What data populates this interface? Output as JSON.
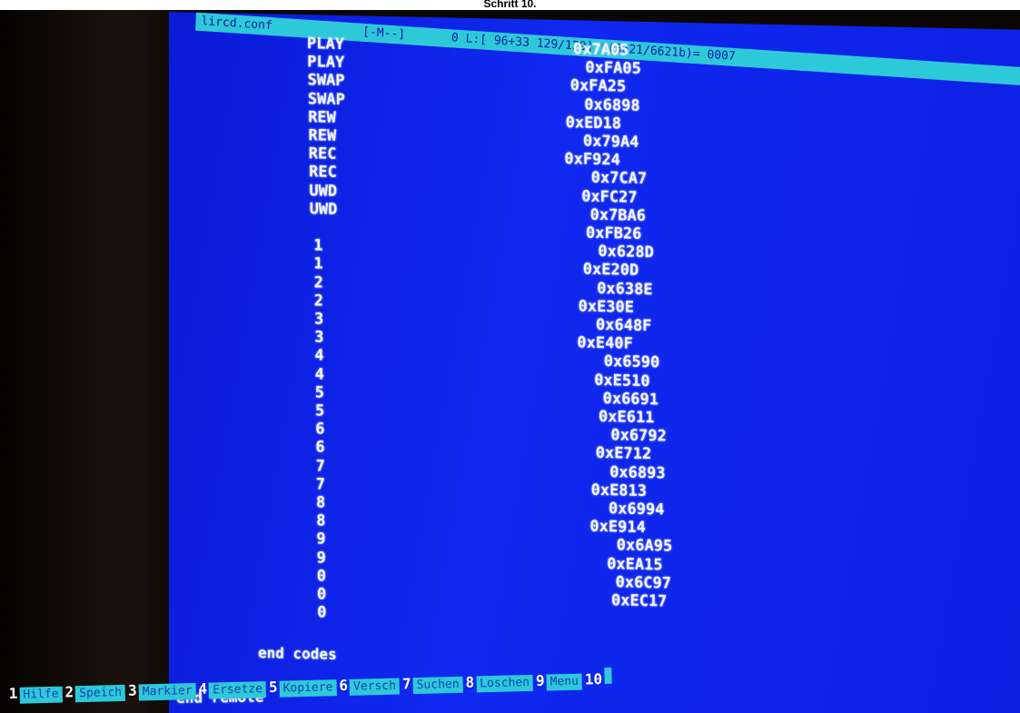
{
  "caption": "Schritt 10.",
  "titlebar": {
    "filename": "lircd.conf",
    "mode": "[-M--]",
    "position": "0 L:[ 96+33 129/129] *(6621/6621b)= 0007"
  },
  "rows": [
    {
      "key": "PLAY",
      "code": "0x7A05"
    },
    {
      "key": "PLAY",
      "code": "0xFA05"
    },
    {
      "key": "SWAP",
      "code": "0xFA25"
    },
    {
      "key": "SWAP",
      "code": "0x6898"
    },
    {
      "key": "REW",
      "code": "0xED18"
    },
    {
      "key": "REW",
      "code": "0x79A4"
    },
    {
      "key": "REC",
      "code": "0xF924"
    },
    {
      "key": "REC",
      "code": "0x7CA7"
    },
    {
      "key": "UWD",
      "code": "0xFC27"
    },
    {
      "key": "UWD",
      "code": "0x7BA6"
    },
    {
      "key": "",
      "code": "0xFB26"
    },
    {
      "key": "1",
      "code": "0x628D"
    },
    {
      "key": "1",
      "code": "0xE20D"
    },
    {
      "key": "2",
      "code": "0x638E"
    },
    {
      "key": "2",
      "code": "0xE30E"
    },
    {
      "key": "3",
      "code": "0x648F"
    },
    {
      "key": "3",
      "code": "0xE40F"
    },
    {
      "key": "4",
      "code": "0x6590"
    },
    {
      "key": "4",
      "code": "0xE510"
    },
    {
      "key": "5",
      "code": "0x6691"
    },
    {
      "key": "5",
      "code": "0xE611"
    },
    {
      "key": "6",
      "code": "0x6792"
    },
    {
      "key": "6",
      "code": "0xE712"
    },
    {
      "key": "7",
      "code": "0x6893"
    },
    {
      "key": "7",
      "code": "0xE813"
    },
    {
      "key": "8",
      "code": "0x6994"
    },
    {
      "key": "8",
      "code": "0xE914"
    },
    {
      "key": "9",
      "code": "0x6A95"
    },
    {
      "key": "9",
      "code": "0xEA15"
    },
    {
      "key": "0",
      "code": "0x6C97"
    },
    {
      "key": "0",
      "code": "0xEC17"
    },
    {
      "key": "0",
      "code": ""
    }
  ],
  "end_codes": "end codes",
  "end_remote": "end remote",
  "function_keys": [
    {
      "num": "1",
      "label": "Hilfe"
    },
    {
      "num": "2",
      "label": "Speich"
    },
    {
      "num": "3",
      "label": "Markier"
    },
    {
      "num": "4",
      "label": "Ersetze"
    },
    {
      "num": "5",
      "label": "Kopiere"
    },
    {
      "num": "6",
      "label": "Versch"
    },
    {
      "num": "7",
      "label": "Suchen"
    },
    {
      "num": "8",
      "label": "Loschen"
    },
    {
      "num": "9",
      "label": "Menu"
    },
    {
      "num": "10",
      "label": ""
    }
  ],
  "colors": {
    "screen": "#1028f0",
    "bar": "#2ec9d8",
    "text": "#f2f5ff"
  }
}
